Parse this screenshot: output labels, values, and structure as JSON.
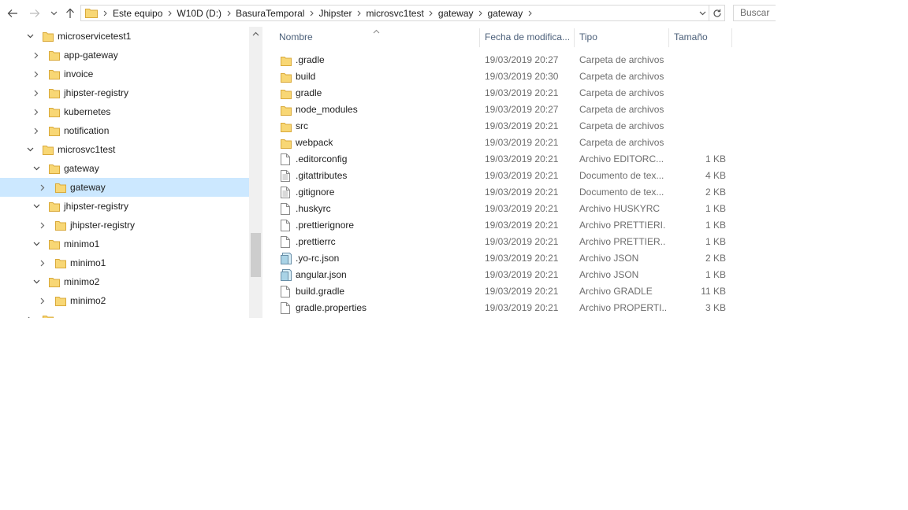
{
  "colors": {
    "folder_fill": "#f8d775",
    "folder_back": "#e8b94a",
    "selection": "#cce8ff",
    "header_text": "#4c607a"
  },
  "nav": {
    "back_icon": "arrow-left-icon",
    "forward_icon": "arrow-right-icon",
    "recent_icon": "chevron-down-icon",
    "up_icon": "arrow-up-icon"
  },
  "address": {
    "crumbs": [
      "Este equipo",
      "W10D (D:)",
      "BasuraTemporal",
      "Jhipster",
      "microsvc1test",
      "gateway",
      "gateway"
    ],
    "search_placeholder": "Buscar e"
  },
  "tree": [
    {
      "label": "microservicetest1",
      "level": 0,
      "state": "expanded",
      "selected": false
    },
    {
      "label": "app-gateway",
      "level": 1,
      "state": "collapsed",
      "selected": false
    },
    {
      "label": "invoice",
      "level": 1,
      "state": "collapsed",
      "selected": false
    },
    {
      "label": "jhipster-registry",
      "level": 1,
      "state": "collapsed",
      "selected": false
    },
    {
      "label": "kubernetes",
      "level": 1,
      "state": "collapsed",
      "selected": false
    },
    {
      "label": "notification",
      "level": 1,
      "state": "collapsed",
      "selected": false
    },
    {
      "label": "microsvc1test",
      "level": 0,
      "state": "expanded",
      "selected": false
    },
    {
      "label": "gateway",
      "level": 1,
      "state": "expanded",
      "selected": false
    },
    {
      "label": "gateway",
      "level": 2,
      "state": "collapsed",
      "selected": true
    },
    {
      "label": "jhipster-registry",
      "level": 1,
      "state": "expanded",
      "selected": false
    },
    {
      "label": "jhipster-registry",
      "level": 2,
      "state": "collapsed",
      "selected": false
    },
    {
      "label": "minimo1",
      "level": 1,
      "state": "expanded",
      "selected": false
    },
    {
      "label": "minimo1",
      "level": 2,
      "state": "collapsed",
      "selected": false
    },
    {
      "label": "minimo2",
      "level": 1,
      "state": "expanded",
      "selected": false
    },
    {
      "label": "minimo2",
      "level": 2,
      "state": "collapsed",
      "selected": false
    },
    {
      "label": "",
      "level": 0,
      "state": "collapsed",
      "selected": false
    }
  ],
  "columns": {
    "name": "Nombre",
    "date": "Fecha de modifica...",
    "type": "Tipo",
    "size": "Tamaño"
  },
  "files": [
    {
      "name": ".gradle",
      "date": "19/03/2019 20:27",
      "type": "Carpeta de archivos",
      "size": "",
      "icon": "folder-icon"
    },
    {
      "name": "build",
      "date": "19/03/2019 20:30",
      "type": "Carpeta de archivos",
      "size": "",
      "icon": "folder-icon"
    },
    {
      "name": "gradle",
      "date": "19/03/2019 20:21",
      "type": "Carpeta de archivos",
      "size": "",
      "icon": "folder-icon"
    },
    {
      "name": "node_modules",
      "date": "19/03/2019 20:27",
      "type": "Carpeta de archivos",
      "size": "",
      "icon": "folder-icon"
    },
    {
      "name": "src",
      "date": "19/03/2019 20:21",
      "type": "Carpeta de archivos",
      "size": "",
      "icon": "folder-icon"
    },
    {
      "name": "webpack",
      "date": "19/03/2019 20:21",
      "type": "Carpeta de archivos",
      "size": "",
      "icon": "folder-icon"
    },
    {
      "name": ".editorconfig",
      "date": "19/03/2019 20:21",
      "type": "Archivo EDITORC...",
      "size": "1 KB",
      "icon": "file-icon"
    },
    {
      "name": ".gitattributes",
      "date": "19/03/2019 20:21",
      "type": "Documento de tex...",
      "size": "4 KB",
      "icon": "text-file-icon"
    },
    {
      "name": ".gitignore",
      "date": "19/03/2019 20:21",
      "type": "Documento de tex...",
      "size": "2 KB",
      "icon": "text-file-icon"
    },
    {
      "name": ".huskyrc",
      "date": "19/03/2019 20:21",
      "type": "Archivo HUSKYRC",
      "size": "1 KB",
      "icon": "file-icon"
    },
    {
      "name": ".prettierignore",
      "date": "19/03/2019 20:21",
      "type": "Archivo PRETTIERI...",
      "size": "1 KB",
      "icon": "file-icon"
    },
    {
      "name": ".prettierrc",
      "date": "19/03/2019 20:21",
      "type": "Archivo PRETTIER...",
      "size": "1 KB",
      "icon": "file-icon"
    },
    {
      "name": ".yo-rc.json",
      "date": "19/03/2019 20:21",
      "type": "Archivo JSON",
      "size": "2 KB",
      "icon": "json-file-icon"
    },
    {
      "name": "angular.json",
      "date": "19/03/2019 20:21",
      "type": "Archivo JSON",
      "size": "1 KB",
      "icon": "json-file-icon"
    },
    {
      "name": "build.gradle",
      "date": "19/03/2019 20:21",
      "type": "Archivo GRADLE",
      "size": "11 KB",
      "icon": "file-icon"
    },
    {
      "name": "gradle.properties",
      "date": "19/03/2019 20:21",
      "type": "Archivo PROPERTI...",
      "size": "3 KB",
      "icon": "file-icon"
    }
  ]
}
